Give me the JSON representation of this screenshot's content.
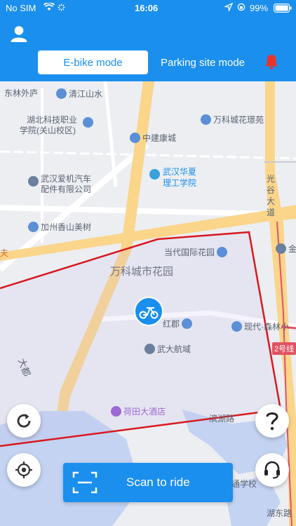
{
  "status_bar": {
    "carrier": "No SIM",
    "time": "16:06",
    "battery": "99%"
  },
  "header": {
    "tabs": [
      {
        "label": "E-bike mode",
        "active": true
      },
      {
        "label": "Parking site mode",
        "active": false
      }
    ]
  },
  "map": {
    "labels": {
      "dongling": "东林外庐",
      "qingjiang": "清江山水",
      "hubei_tech_1": "湖北科技职业",
      "hubei_tech_2": "学院(关山校区)",
      "wanke_huanjing": "万科城花璟苑",
      "zhongjian": "中建康城",
      "wuhan_aiji_1": "武汉爱机汽车",
      "wuhan_aiji_2": "配件有限公司",
      "wuhan_huaxia_1": "武汉华夏",
      "wuhan_huaxia_2": "理工学院",
      "guanggu_1": "光",
      "guanggu_2": "谷",
      "guanggu_3": "大",
      "guanggu_4": "道",
      "jiazhou": "加州香山美树",
      "dangdai": "当代国际花园",
      "wanke_huayuan": "万科城市花园",
      "hongjun": "红郡",
      "xiandai": "现代·森林小",
      "wuda_hangyu": "武大航域",
      "line2": "2号线",
      "hetian": "荷田大酒店",
      "binhu": "滨湖路",
      "jiu": "金",
      "tongxuexiao": "通学校",
      "hudong": "湖东路",
      "dadu": "大都",
      "fu": "夫"
    }
  },
  "scan_button": {
    "label": "Scan to ride"
  },
  "colors": {
    "brand": "#1a8fee",
    "zone": "#d7191f",
    "alert": "#e8352b"
  }
}
